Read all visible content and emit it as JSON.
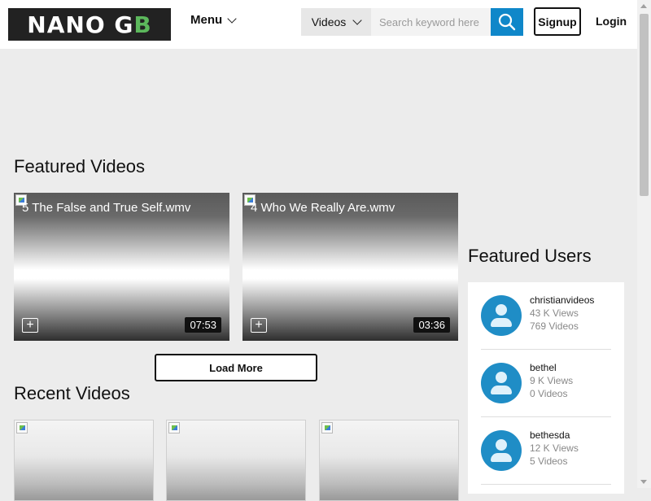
{
  "header": {
    "logo_text_main": "NANO G",
    "logo_text_accent": "B",
    "menu_label": "Menu",
    "search": {
      "type_label": "Videos",
      "placeholder": "Search keyword here"
    },
    "signup_label": "Signup",
    "login_label": "Login"
  },
  "featured_videos": {
    "title": "Featured Videos",
    "items": [
      {
        "title": "5 The False and True Self.wmv",
        "duration": "07:53"
      },
      {
        "title": "4 Who We Really Are.wmv",
        "duration": "03:36"
      }
    ],
    "load_more_label": "Load More"
  },
  "recent_videos": {
    "title": "Recent Videos",
    "items": [
      {},
      {},
      {}
    ]
  },
  "featured_users": {
    "title": "Featured Users",
    "items": [
      {
        "name": "christianvideos",
        "views": "43 K Views",
        "videos": "769 Videos"
      },
      {
        "name": "bethel",
        "views": "9 K Views",
        "videos": "0 Videos"
      },
      {
        "name": "bethesda",
        "views": "12 K Views",
        "videos": "5 Videos"
      }
    ]
  },
  "colors": {
    "accent": "#0f87c9",
    "avatar": "#1f8dc6",
    "logo_accent": "#5cb85c",
    "background": "#ececec"
  },
  "icons": {
    "search": "search-icon",
    "menu_chevron": "chevron-down-icon",
    "type_chevron": "chevron-down-icon",
    "add": "plus-icon",
    "avatar": "user-icon"
  }
}
